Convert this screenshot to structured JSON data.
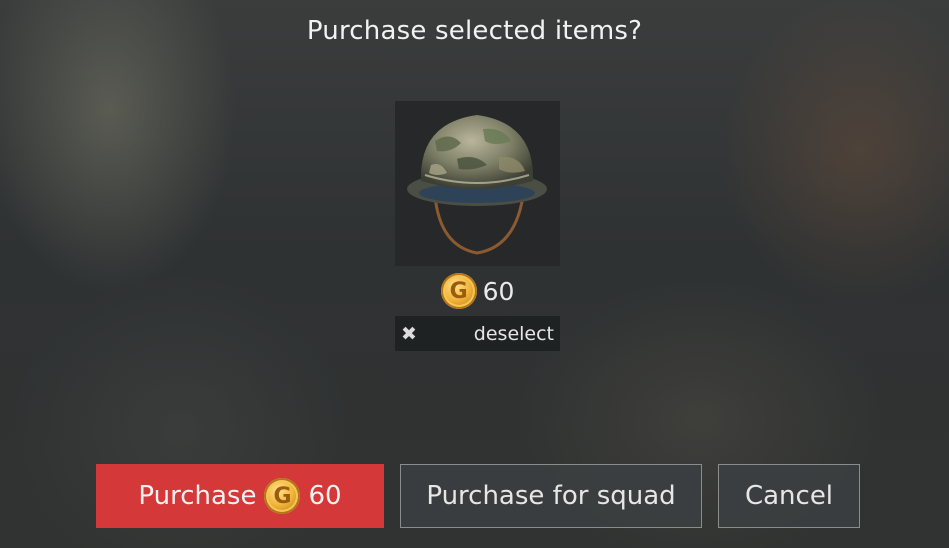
{
  "dialog": {
    "title": "Purchase selected items?",
    "item": {
      "icon": "helmet-icon",
      "price": "60",
      "currency_icon": "gold-coin-icon",
      "currency_symbol": "G",
      "deselect_label": "deselect",
      "deselect_icon_glyph": "✖"
    },
    "buttons": {
      "purchase_label": "Purchase",
      "purchase_price": "60",
      "purchase_for_squad_label": "Purchase for squad",
      "cancel_label": "Cancel"
    }
  },
  "colors": {
    "primary_button": "#d43838",
    "gold": "#f2b53a"
  }
}
